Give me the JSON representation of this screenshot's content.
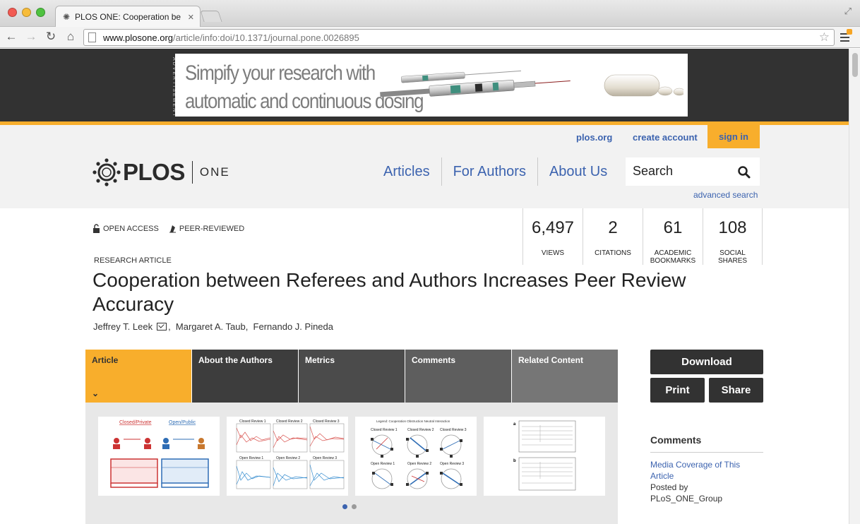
{
  "browser": {
    "tab_title": "PLOS ONE: Cooperation betw",
    "url_host": "www.plosone.org",
    "url_path": "/article/info:doi/10.1371/journal.pone.0026895"
  },
  "ad": {
    "label": "ADVERTISEMENT",
    "line1": "Simpify your research with",
    "line2": "automatic and continuous dosing"
  },
  "header": {
    "util_links": [
      "plos.org",
      "create account",
      "sign in"
    ],
    "logo_word": "PLOS",
    "logo_journal": "ONE",
    "nav": [
      "Articles",
      "For Authors",
      "About Us"
    ],
    "search_text": "Search",
    "advanced_search": "advanced search"
  },
  "article": {
    "badges": [
      "OPEN ACCESS",
      "PEER-REVIEWED"
    ],
    "metrics": [
      {
        "value": "6,497",
        "label": "VIEWS"
      },
      {
        "value": "2",
        "label": "CITATIONS"
      },
      {
        "value": "61",
        "label": "ACADEMIC\nBOOKMARKS"
      },
      {
        "value": "108",
        "label": "SOCIAL\nSHARES"
      }
    ],
    "type": "RESEARCH ARTICLE",
    "title": "Cooperation between Referees and Authors Increases Peer Review Accuracy",
    "authors": [
      "Jeffrey T. Leek",
      "Margaret A. Taub",
      "Fernando J. Pineda"
    ],
    "tabs": [
      "Article",
      "About the Authors",
      "Metrics",
      "Comments",
      "Related Content"
    ]
  },
  "sidebar": {
    "download": "Download",
    "print": "Print",
    "share": "Share",
    "comments_heading": "Comments",
    "comment_title": "Media Coverage of This Article",
    "comment_posted_by": "Posted by",
    "comment_author": "PLoS_ONE_Group"
  },
  "figure_text": {
    "fig1_left": "Closed/Private",
    "fig1_right": "Open/Public",
    "fig2_titles": [
      "Closed Review 1",
      "Closed Review 2",
      "Closed Review 3",
      "Open Review 1",
      "Open Review 2",
      "Open Review 3"
    ],
    "fig3_legend": "Legend: Cooperation  Obstruction  Neutral Interaction",
    "fig4_labels": [
      "a",
      "b"
    ]
  },
  "colors": {
    "accent": "#f8ae2c",
    "link": "#3c63af",
    "dark": "#323232"
  }
}
